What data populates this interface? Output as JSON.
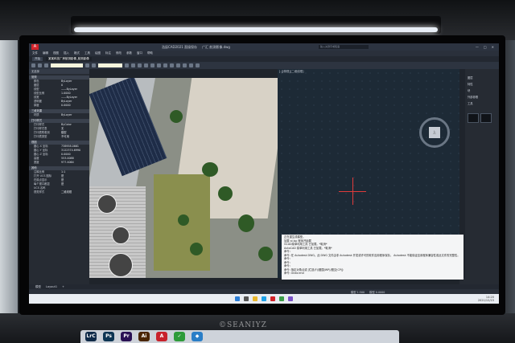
{
  "titlebar": {
    "app_badge": "A",
    "window_title": "浩辰CAD2021  直接保存",
    "file_name": "广汇 航测影像.dwg",
    "search_placeholder": "输入关键字或短语"
  },
  "menus": [
    "文件",
    "编辑",
    "视图",
    "插入",
    "格式",
    "工具",
    "绘图",
    "标注",
    "修改",
    "参数",
    "窗口",
    "帮助"
  ],
  "doc_tabs": [
    {
      "label": "开始",
      "active": false
    },
    {
      "label": "某某科技厂房航测影像_航测影像",
      "active": true
    }
  ],
  "properties": {
    "selector": "无选择",
    "sections": [
      {
        "title": "常规",
        "rows": [
          {
            "k": "颜色",
            "v": "ByLayer"
          },
          {
            "k": "图层",
            "v": "0"
          },
          {
            "k": "线型",
            "v": "——ByLayer"
          },
          {
            "k": "线型比例",
            "v": "1.0000"
          },
          {
            "k": "线宽",
            "v": "——ByLayer"
          },
          {
            "k": "透明度",
            "v": "ByLayer"
          },
          {
            "k": "厚度",
            "v": "0.0000"
          }
        ]
      },
      {
        "title": "三维效果",
        "rows": [
          {
            "k": "材质",
            "v": "ByLayer"
          }
        ]
      },
      {
        "title": "打印样式",
        "rows": [
          {
            "k": "打印样式",
            "v": "ByColor"
          },
          {
            "k": "打印样式表",
            "v": "无"
          },
          {
            "k": "打印表附着到",
            "v": "模型"
          },
          {
            "k": "打印表类型",
            "v": "不可用"
          }
        ]
      },
      {
        "title": "视图",
        "rows": [
          {
            "k": "圆心 X 坐标",
            "v": "738958.0661"
          },
          {
            "k": "圆心 Y 坐标",
            "v": "3122374.6990"
          },
          {
            "k": "圆心 Z 坐标",
            "v": "0.0000"
          },
          {
            "k": "高度",
            "v": "553.0088"
          },
          {
            "k": "宽度",
            "v": "977.4064"
          }
        ]
      },
      {
        "title": "其他",
        "rows": [
          {
            "k": "注释比例",
            "v": "1:1"
          },
          {
            "k": "打开 UCS 图标",
            "v": "是"
          },
          {
            "k": "在原点显示",
            "v": "是"
          },
          {
            "k": "每个视口都显",
            "v": "是"
          },
          {
            "k": "UCS 名称",
            "v": ""
          },
          {
            "k": "视觉样式",
            "v": "二维线框"
          }
        ]
      }
    ]
  },
  "model_label": "[-][俯视][二维线框]",
  "viewcube_face": "上",
  "right_panel": {
    "items": [
      "图层",
      "特性",
      "块",
      "外部参照",
      "工具"
    ]
  },
  "command_lines": [
    "正在重生成模型。",
    "加载 ai.lsp 程序开始载",
    "GCAD菜单利用工具 已加载。*取消*",
    "AutoCAD 菜单利用工具 已加载。*取消*",
    "命令:",
    "命令: 在 Autodesk DWG。此 DWG 文件由非 Autodesk 开发或许可的软件应用程序保存。 Autodesk 不能保证应用程序兼容性或此文件的完整性。",
    "命令:",
    "命令:",
    "命令:",
    "命令: 指定对角点或 [栏选(F)/圈围(WP)/圈交(CP)]:",
    "命令: Undo:end"
  ],
  "layout_tabs": [
    "模型",
    "Layout1",
    "+"
  ],
  "status_bar": {
    "scale": "模型 1:500",
    "coords": "模型 0.0000"
  },
  "taskbar": {
    "time": "14:20",
    "date": "2021/12/15"
  },
  "dock_apps": [
    {
      "name": "LrC",
      "color": "#0f2a48"
    },
    {
      "name": "Ps",
      "color": "#0d3553"
    },
    {
      "name": "Pr",
      "color": "#2a1154"
    },
    {
      "name": "Ai",
      "color": "#4a2500"
    },
    {
      "name": "A",
      "color": "#c8222b"
    },
    {
      "name": "✓",
      "color": "#2e9b3a"
    },
    {
      "name": "◆",
      "color": "#2a7ec7"
    }
  ],
  "watermark": "©SEANIYZ"
}
